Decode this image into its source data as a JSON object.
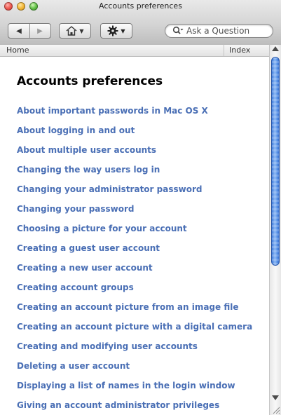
{
  "window": {
    "title": "Accounts preferences"
  },
  "toolbar": {
    "search_placeholder": "Ask a Question"
  },
  "breadcrumb": {
    "home": "Home",
    "index": "Index"
  },
  "page": {
    "title": "Accounts preferences"
  },
  "topics": [
    "About important passwords in Mac OS X",
    "About logging in and out",
    "About multiple user accounts",
    "Changing the way users log in",
    "Changing your administrator password",
    "Changing your password",
    "Choosing a picture for your account",
    "Creating a guest user account",
    "Creating a new user account",
    "Creating account groups",
    "Creating an account picture from an image file",
    "Creating an account picture with a digital camera",
    "Creating and modifying user accounts",
    "Deleting a user account",
    "Displaying a list of names in the login window",
    "Giving an account administrator privileges"
  ],
  "colors": {
    "link": "#4a6fb5",
    "scroll_thumb": "#5a94e8"
  }
}
